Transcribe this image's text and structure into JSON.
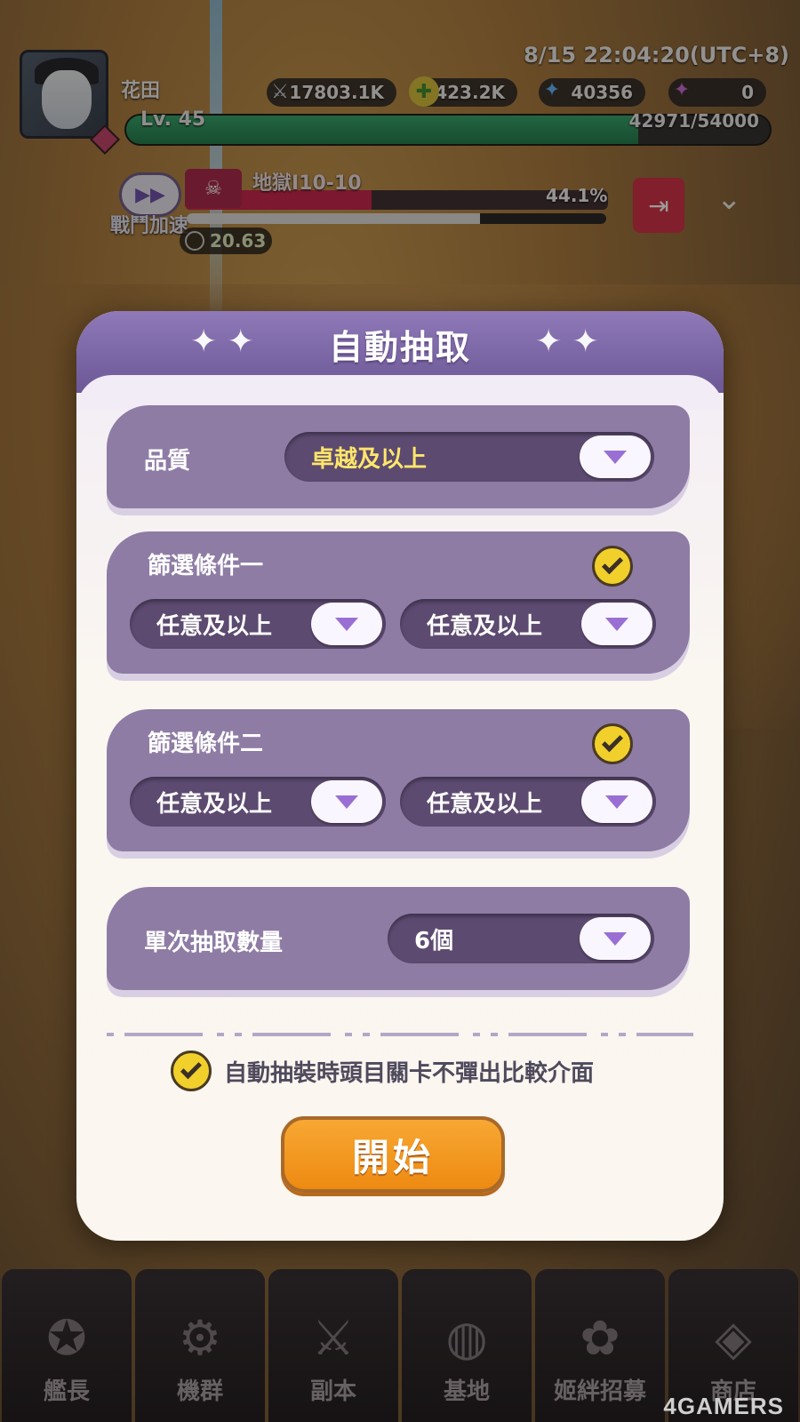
{
  "status": {
    "timestamp": "8/15 22:04:20(UTC+8)"
  },
  "player": {
    "name": "花田",
    "level": "Lv. 45",
    "exp": "42971/54000",
    "exp_fraction": 0.7957,
    "power": "17803.1K",
    "gold": "1423.2K",
    "crystals": "40356",
    "special": "0"
  },
  "battle": {
    "speed_label": "戰鬥加速",
    "stage": "地獄I10-10",
    "hp_percent": "44.1%",
    "hp_fraction": 0.441,
    "progress_fraction": 0.7,
    "timer": "20.63"
  },
  "modal": {
    "title": "自動抽取",
    "quality": {
      "label": "品質",
      "value": "卓越及以上"
    },
    "filter1": {
      "label": "篩選條件一",
      "checked": true,
      "left_value": "任意及以上",
      "right_value": "任意及以上"
    },
    "filter2": {
      "label": "篩選條件二",
      "checked": true,
      "left_value": "任意及以上",
      "right_value": "任意及以上"
    },
    "quantity": {
      "label": "單次抽取數量",
      "value": "6個"
    },
    "compare_option": {
      "label": "自動抽裝時頭目關卡不彈出比較介面",
      "checked": true
    },
    "start_label": "開始"
  },
  "nav": {
    "tabs": [
      {
        "label": "艦長",
        "icon": "captain-icon"
      },
      {
        "label": "機群",
        "icon": "fleet-icon"
      },
      {
        "label": "副本",
        "icon": "crossed-swords-icon"
      },
      {
        "label": "基地",
        "icon": "planet-base-icon"
      },
      {
        "label": "姬絆招募",
        "icon": "recruit-icon"
      },
      {
        "label": "商店",
        "icon": "shop-icon"
      }
    ]
  },
  "watermark": "4GAMERS",
  "colors": {
    "modal_header": "#7b66a6",
    "card": "#8e7ca5",
    "dropdown": "#5c4a70",
    "quality_gold": "#ffe66a",
    "start_button": "#f29a22",
    "checkbox": "#f2d02c"
  }
}
